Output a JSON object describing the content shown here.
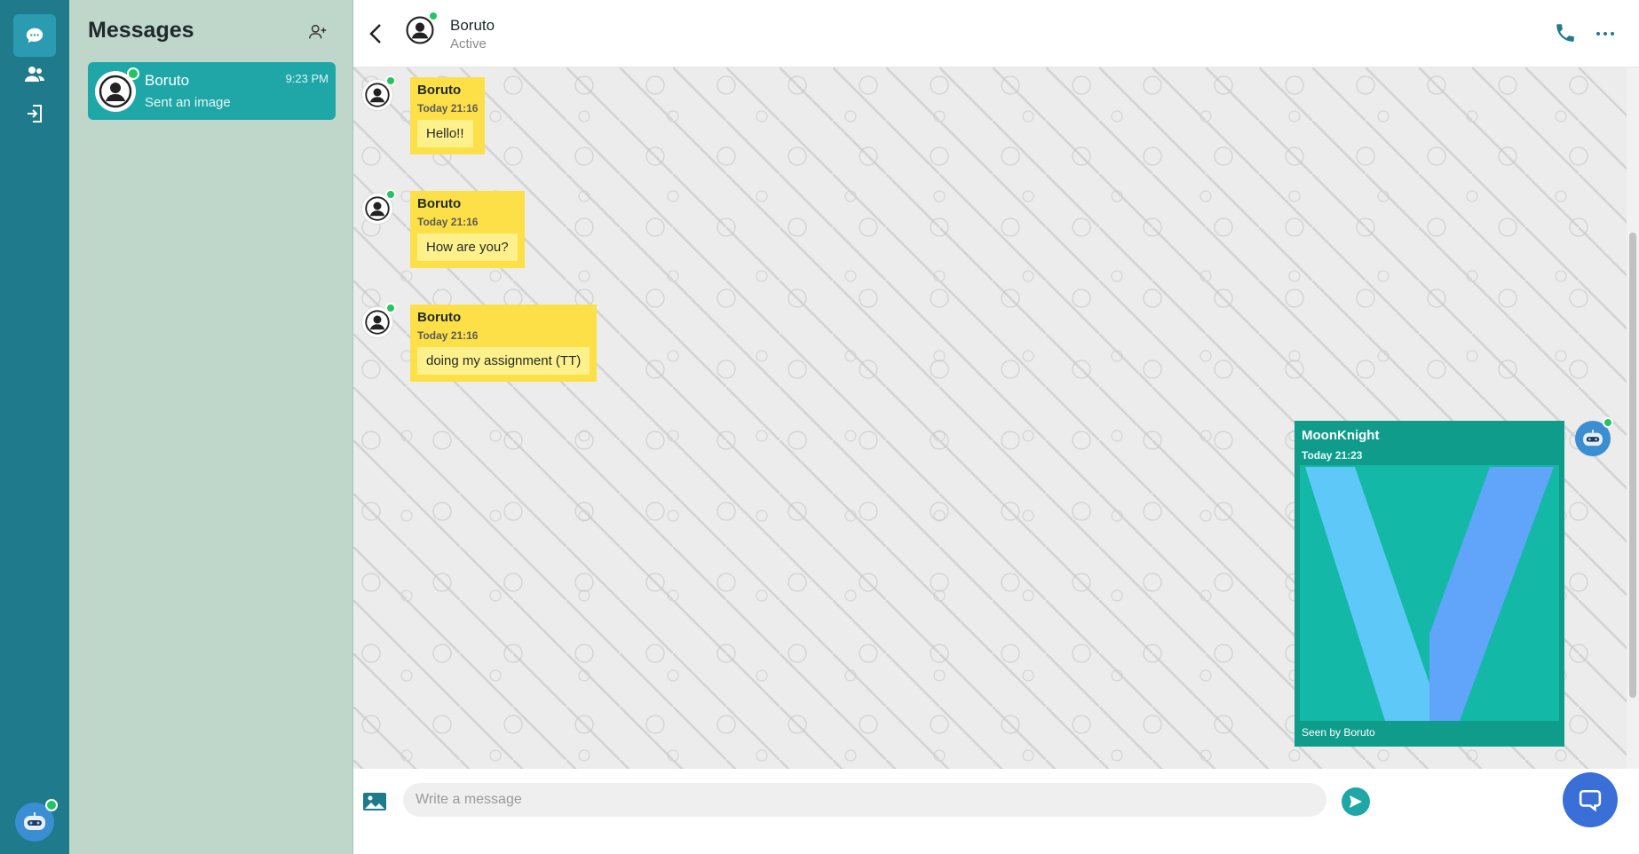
{
  "sidebar": {
    "items": [
      {
        "icon": "chat-icon",
        "active": true
      },
      {
        "icon": "contacts-icon",
        "active": false
      },
      {
        "icon": "logout-icon",
        "active": false
      }
    ],
    "current_user_icon": "robot-avatar"
  },
  "panel": {
    "title": "Messages",
    "conversations": [
      {
        "name": "Boruto",
        "preview": "Sent an image",
        "time": "9:23 PM",
        "online": true
      }
    ]
  },
  "header": {
    "contact_name": "Boruto",
    "status": "Active"
  },
  "messages": [
    {
      "sender": "Boruto",
      "time": "Today 21:16",
      "text": "Hello!!"
    },
    {
      "sender": "Boruto",
      "time": "Today 21:16",
      "text": "How are you?"
    },
    {
      "sender": "Boruto",
      "time": "Today 21:16",
      "text": "doing my assignment (TT)"
    }
  ],
  "outgoing": {
    "sender": "MoonKnight",
    "time": "Today 21:23",
    "seen": "Seen by Boruto",
    "attachment": "image"
  },
  "composer": {
    "placeholder": "Write a message"
  },
  "colors": {
    "rail": "#1f7a8c",
    "panel": "#bfd6cb",
    "accent": "#1fa7a7",
    "incoming_bubble": "#fde047",
    "outgoing_bubble": "#0f9c8a",
    "online": "#22c55e"
  }
}
